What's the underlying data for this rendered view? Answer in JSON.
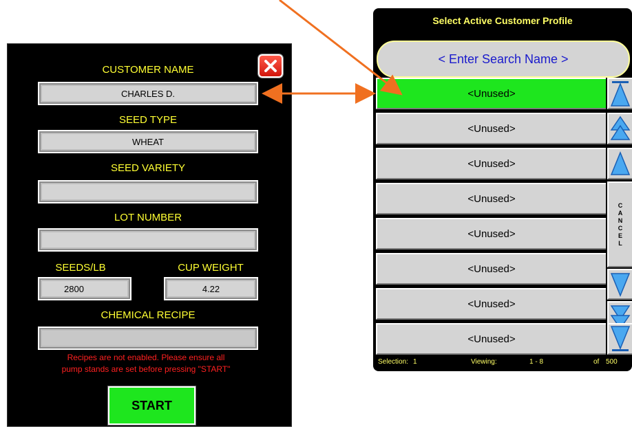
{
  "customer_form": {
    "customer_name_label": "CUSTOMER NAME",
    "customer_name_value": "CHARLES D.",
    "seed_type_label": "SEED TYPE",
    "seed_type_value": "WHEAT",
    "seed_variety_label": "SEED VARIETY",
    "seed_variety_value": "",
    "lot_number_label": "LOT NUMBER",
    "lot_number_value": "",
    "seeds_per_lb_label": "SEEDS/LB",
    "seeds_per_lb_value": "2800",
    "cup_weight_label": "CUP WEIGHT",
    "cup_weight_value": "4.22",
    "chemical_recipe_label": "CHEMICAL RECIPE",
    "chemical_recipe_value": "",
    "warning_line1": "Recipes are not enabled.  Please ensure all",
    "warning_line2": "pump stands are set before pressing \"START\"",
    "start_label": "START",
    "close_icon": "close-icon"
  },
  "profile_selector": {
    "title": "Select Active Customer Profile",
    "search_placeholder": "< Enter Search Name >",
    "rows": [
      "<Unused>",
      "<Unused>",
      "<Unused>",
      "<Unused>",
      "<Unused>",
      "<Unused>",
      "<Unused>",
      "<Unused>"
    ],
    "selected_index": 0,
    "cancel_letters": [
      "C",
      "A",
      "N",
      "C",
      "E",
      "L"
    ],
    "status": {
      "selection_label": "Selection:",
      "selection_value": "1",
      "viewing_label": "Viewing:",
      "viewing_value": "1 - 8",
      "of_label": "of",
      "total": "500"
    }
  },
  "colors": {
    "label_yellow": "#ffff33",
    "selected_green": "#1ee61e",
    "arrow_orange": "#f07020",
    "scroll_blue": "#4aa8f0",
    "warning_red": "#ff2020"
  }
}
